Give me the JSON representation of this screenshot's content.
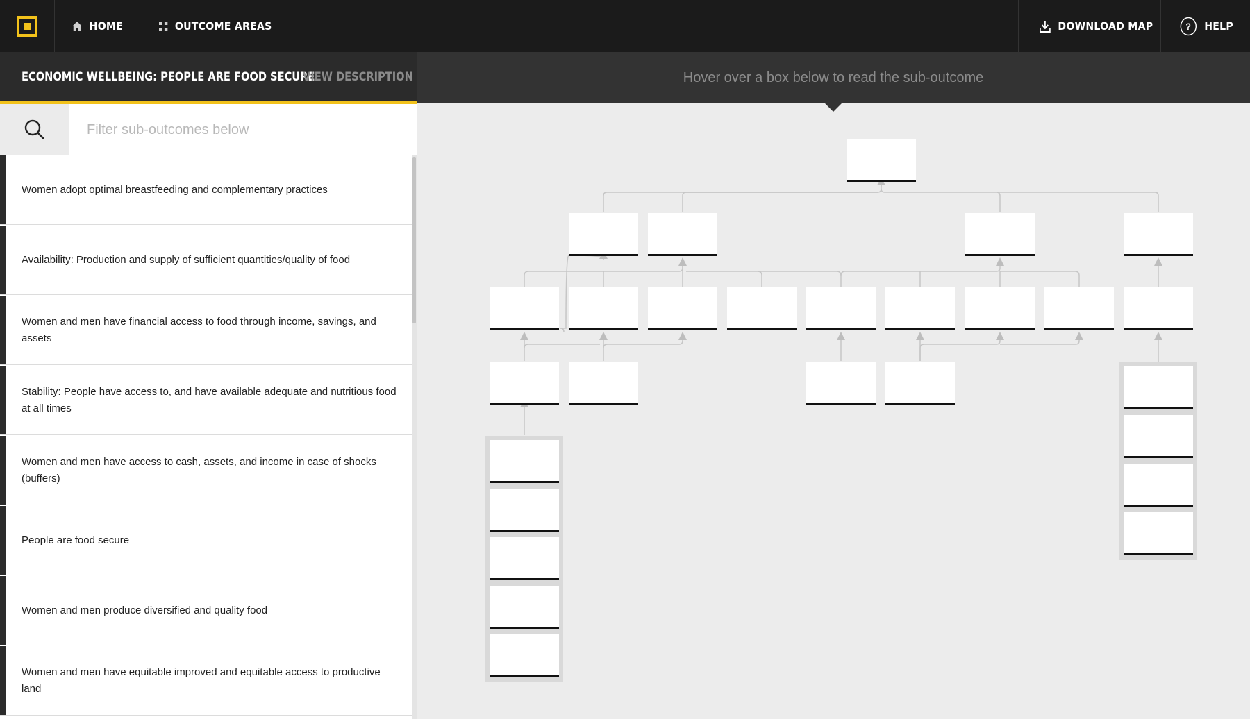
{
  "topbar": {
    "home_label": "HOME",
    "outcome_areas_label": "OUTCOME AREAS",
    "download_label": "DOWNLOAD MAP",
    "help_label": "HELP",
    "help_symbol": "?"
  },
  "outcome": {
    "title": "ECONOMIC WELLBEING: PEOPLE ARE FOOD SECURE",
    "view_description_label": "VIEW DESCRIPTION"
  },
  "map": {
    "hint": "Hover over a box below to read the sub-outcome"
  },
  "search": {
    "placeholder": "Filter sub-outcomes below"
  },
  "sub_outcomes": [
    "Women adopt optimal breastfeeding and complementary practices",
    "Availability: Production and supply of sufficient quantities/quality of food",
    "Women and men have financial access to food through income, savings, and assets",
    "Stability: People have access to, and have available adequate and nutritious food at all times",
    "Women and men have access to cash, assets, and income in case of shocks (buffers)",
    "People are food secure",
    "Women and men produce diversified and quality food",
    "Women and men have equitable improved and equitable access to productive land"
  ],
  "colors": {
    "accent": "#f2c21b",
    "topbar_bg": "#1b1b1b",
    "header_bg": "#2b2b2b",
    "map_bg": "#ececec"
  },
  "icons": [
    "logo",
    "home-icon",
    "grid-icon",
    "download-icon",
    "help-icon",
    "search-icon"
  ]
}
